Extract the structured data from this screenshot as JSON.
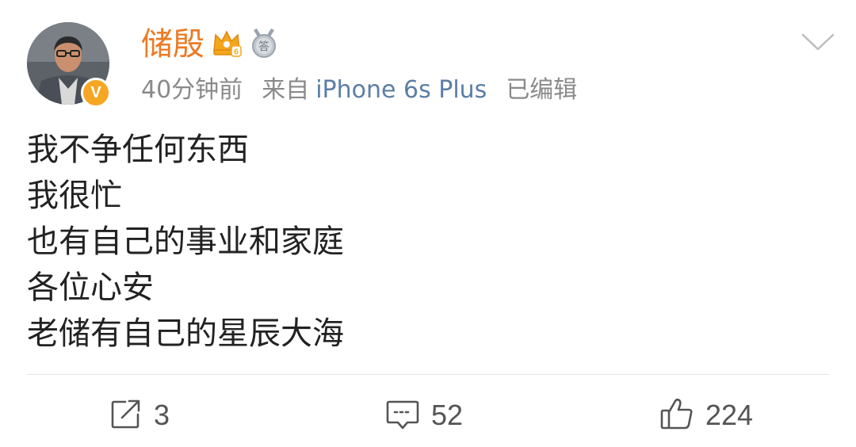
{
  "post": {
    "author": {
      "name": "储殷",
      "verified_badge_glyph": "V",
      "crown_badge_level": "6",
      "medal_badge_glyph": "答"
    },
    "meta": {
      "time": "40分钟前",
      "from_label": "来自",
      "device": "iPhone 6s Plus",
      "edited": "已编辑"
    },
    "lines": [
      "我不争任何东西",
      "我很忙",
      "也有自己的事业和家庭",
      "各位心安",
      "老储有自己的星辰大海"
    ]
  },
  "actions": {
    "repost_count": "3",
    "comment_count": "52",
    "like_count": "224"
  },
  "colors": {
    "username": "#ec7a24",
    "device_link": "#5b7ea6",
    "meta_gray": "#8a8a8a",
    "verified": "#f5a623"
  },
  "icons": {
    "more": "chevron-down-icon",
    "repost": "repost-icon",
    "comment": "comment-icon",
    "like": "like-icon"
  }
}
